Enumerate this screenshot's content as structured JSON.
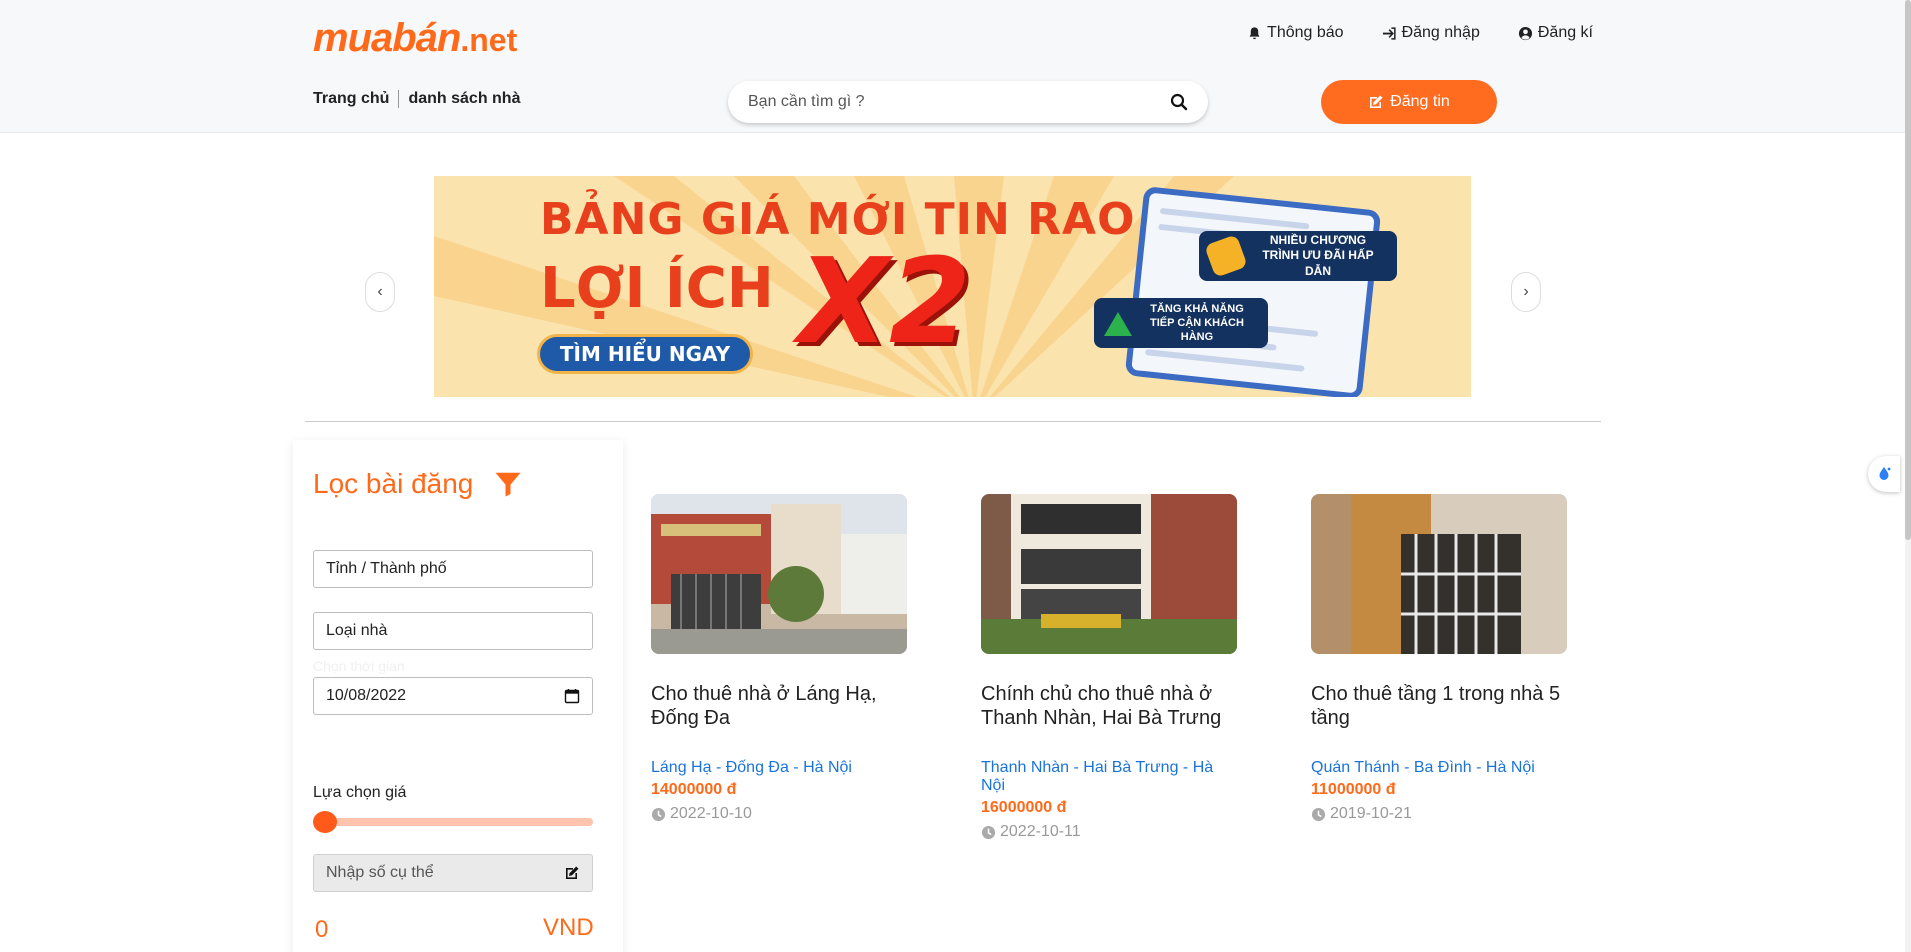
{
  "header": {
    "logo_brand": "muabán",
    "logo_tld": ".net",
    "links": [
      {
        "label": "Thông báo",
        "icon": "bell-icon"
      },
      {
        "label": "Đăng nhập",
        "icon": "sign-in-icon"
      },
      {
        "label": "Đăng kí",
        "icon": "user-circle-icon"
      }
    ],
    "nav": [
      "Trang chủ",
      "danh sách nhà"
    ],
    "search_placeholder": "Bạn cần tìm gì ?",
    "post_button": "Đăng tin"
  },
  "banner": {
    "line1": "BẢNG GIÁ MỚI TIN RAO",
    "line2": "LỢI ÍCH",
    "big": "X2",
    "cta": "TÌM HIỂU NGAY",
    "tag1": "NHIỀU CHƯƠNG TRÌNH ƯU ĐÃI HẤP DẪN",
    "tag2": "TĂNG KHẢ NĂNG TIẾP CẬN KHÁCH HÀNG",
    "prev": "‹",
    "next": "›"
  },
  "filter": {
    "title": "Lọc bài đăng",
    "city_placeholder": "Tỉnh / Thành phố",
    "type_placeholder": "Loại nhà",
    "time_hint": "Chọn thời gian",
    "date_value": "10/08/2022",
    "price_label": "Lựa chọn giá",
    "slider_fraction": 0,
    "specific_placeholder": "Nhập số cụ thể",
    "price_value": "0",
    "price_unit": "VND"
  },
  "listings": [
    {
      "title": "Cho thuê nhà ở Láng Hạ, Đống Đa",
      "location": "Láng Hạ - Đống Đa - Hà Nội",
      "price": "14000000 đ",
      "date": "2022-10-10"
    },
    {
      "title": "Chính chủ cho thuê nhà ở Thanh Nhàn, Hai Bà Trưng",
      "location": "Thanh Nhàn - Hai Bà Trưng - Hà Nội",
      "price": "16000000 đ",
      "date": "2022-10-11"
    },
    {
      "title": "Cho thuê tầng 1 trong nhà 5 tầng",
      "location": "Quán Thánh - Ba Đình - Hà Nội",
      "price": "11000000 đ",
      "date": "2019-10-21"
    }
  ],
  "colors": {
    "accent": "#ff6a1a",
    "link": "#1a73d9"
  }
}
